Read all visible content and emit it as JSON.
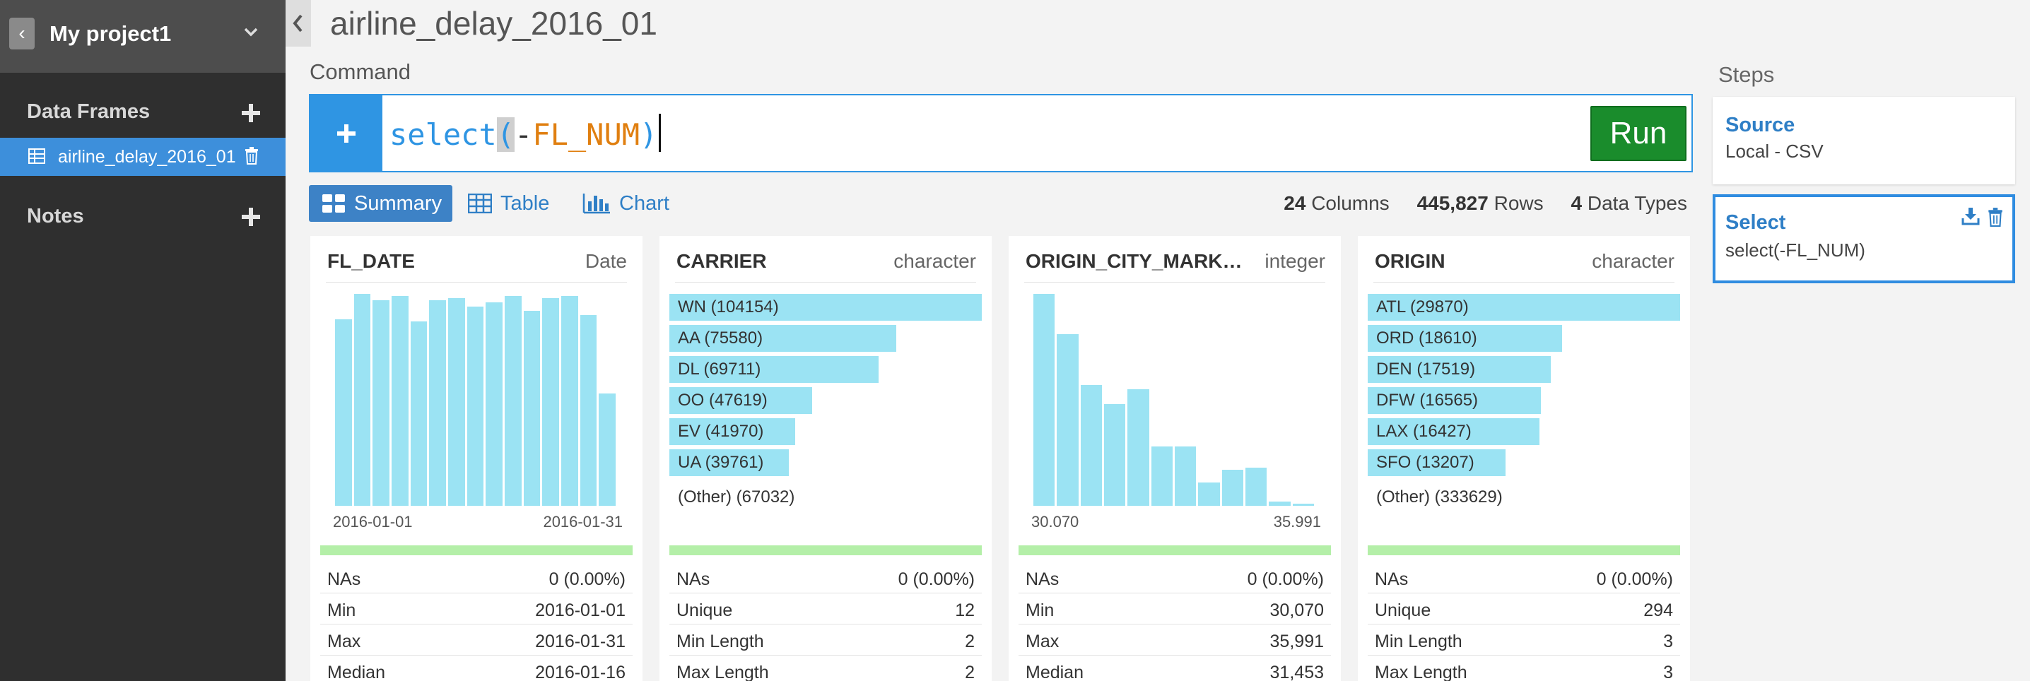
{
  "project": {
    "name": "My project1"
  },
  "sidebar": {
    "data_frames_label": "Data Frames",
    "data_frame_item": "airline_delay_2016_01",
    "notes_label": "Notes"
  },
  "page_title": "airline_delay_2016_01",
  "command": {
    "label": "Command",
    "fn": "select",
    "open": "(",
    "op": "-",
    "arg": "FL_NUM",
    "close": ")",
    "run_label": "Run"
  },
  "tabs": {
    "summary": "Summary",
    "table": "Table",
    "chart": "Chart"
  },
  "stats": {
    "columns": "24",
    "columns_label": "Columns",
    "rows": "445,827",
    "rows_label": "Rows",
    "types": "4",
    "types_label": "Data Types"
  },
  "colors": {
    "accent": "#2f95e3",
    "run": "#1a8c2c",
    "bar": "#9be3f3",
    "na_bar": "#b4efa8",
    "sidebar": "#2f2f2f",
    "selected": "#3d8fdb"
  },
  "cards": [
    {
      "name": "FL_DATE",
      "type": "Date",
      "chart_kind": "histogram",
      "hist": [
        0.88,
        1.0,
        0.97,
        0.99,
        0.87,
        0.97,
        0.98,
        0.94,
        0.96,
        0.99,
        0.92,
        0.98,
        0.99,
        0.9,
        0.53
      ],
      "axis_min": "2016-01-01",
      "axis_max": "2016-01-31",
      "stats": [
        [
          "NAs",
          "0 (0.00%)"
        ],
        [
          "Min",
          "2016-01-01"
        ],
        [
          "Max",
          "2016-01-31"
        ],
        [
          "Median",
          "2016-01-16"
        ]
      ]
    },
    {
      "name": "CARRIER",
      "type": "character",
      "chart_kind": "topn",
      "top": [
        [
          "WN (104154)",
          104154
        ],
        [
          "AA (75580)",
          75580
        ],
        [
          "DL (69711)",
          69711
        ],
        [
          "OO (47619)",
          47619
        ],
        [
          "EV (41970)",
          41970
        ],
        [
          "UA (39761)",
          39761
        ]
      ],
      "other": "(Other) (67032)",
      "stats": [
        [
          "NAs",
          "0 (0.00%)"
        ],
        [
          "Unique",
          "12"
        ],
        [
          "Min Length",
          "2"
        ],
        [
          "Max Length",
          "2"
        ]
      ]
    },
    {
      "name": "ORIGIN_CITY_MARK…",
      "type": "integer",
      "chart_kind": "histogram",
      "hist": [
        1.0,
        0.81,
        0.57,
        0.48,
        0.55,
        0.28,
        0.28,
        0.11,
        0.17,
        0.18,
        0.02,
        0.01
      ],
      "axis_min": "30.070",
      "axis_max": "35.991",
      "stats": [
        [
          "NAs",
          "0 (0.00%)"
        ],
        [
          "Min",
          "30,070"
        ],
        [
          "Max",
          "35,991"
        ],
        [
          "Median",
          "31,453"
        ]
      ]
    },
    {
      "name": "ORIGIN",
      "type": "character",
      "chart_kind": "topn",
      "top": [
        [
          "ATL (29870)",
          29870
        ],
        [
          "ORD (18610)",
          18610
        ],
        [
          "DEN (17519)",
          17519
        ],
        [
          "DFW (16565)",
          16565
        ],
        [
          "LAX (16427)",
          16427
        ],
        [
          "SFO (13207)",
          13207
        ]
      ],
      "other": "(Other) (333629)",
      "stats": [
        [
          "NAs",
          "0 (0.00%)"
        ],
        [
          "Unique",
          "294"
        ],
        [
          "Min Length",
          "3"
        ],
        [
          "Max Length",
          "3"
        ]
      ]
    }
  ],
  "steps": {
    "label": "Steps",
    "items": [
      {
        "name": "Source",
        "desc": "Local - CSV"
      },
      {
        "name": "Select",
        "desc": "select(-FL_NUM)"
      }
    ]
  }
}
